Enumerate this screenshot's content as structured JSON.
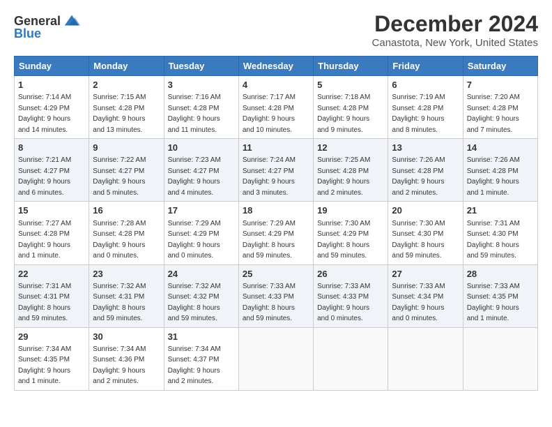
{
  "header": {
    "logo_general": "General",
    "logo_blue": "Blue",
    "main_title": "December 2024",
    "subtitle": "Canastota, New York, United States"
  },
  "days_of_week": [
    "Sunday",
    "Monday",
    "Tuesday",
    "Wednesday",
    "Thursday",
    "Friday",
    "Saturday"
  ],
  "weeks": [
    [
      {
        "day": "1",
        "info": "Sunrise: 7:14 AM\nSunset: 4:29 PM\nDaylight: 9 hours\nand 14 minutes."
      },
      {
        "day": "2",
        "info": "Sunrise: 7:15 AM\nSunset: 4:28 PM\nDaylight: 9 hours\nand 13 minutes."
      },
      {
        "day": "3",
        "info": "Sunrise: 7:16 AM\nSunset: 4:28 PM\nDaylight: 9 hours\nand 11 minutes."
      },
      {
        "day": "4",
        "info": "Sunrise: 7:17 AM\nSunset: 4:28 PM\nDaylight: 9 hours\nand 10 minutes."
      },
      {
        "day": "5",
        "info": "Sunrise: 7:18 AM\nSunset: 4:28 PM\nDaylight: 9 hours\nand 9 minutes."
      },
      {
        "day": "6",
        "info": "Sunrise: 7:19 AM\nSunset: 4:28 PM\nDaylight: 9 hours\nand 8 minutes."
      },
      {
        "day": "7",
        "info": "Sunrise: 7:20 AM\nSunset: 4:28 PM\nDaylight: 9 hours\nand 7 minutes."
      }
    ],
    [
      {
        "day": "8",
        "info": "Sunrise: 7:21 AM\nSunset: 4:27 PM\nDaylight: 9 hours\nand 6 minutes."
      },
      {
        "day": "9",
        "info": "Sunrise: 7:22 AM\nSunset: 4:27 PM\nDaylight: 9 hours\nand 5 minutes."
      },
      {
        "day": "10",
        "info": "Sunrise: 7:23 AM\nSunset: 4:27 PM\nDaylight: 9 hours\nand 4 minutes."
      },
      {
        "day": "11",
        "info": "Sunrise: 7:24 AM\nSunset: 4:27 PM\nDaylight: 9 hours\nand 3 minutes."
      },
      {
        "day": "12",
        "info": "Sunrise: 7:25 AM\nSunset: 4:28 PM\nDaylight: 9 hours\nand 2 minutes."
      },
      {
        "day": "13",
        "info": "Sunrise: 7:26 AM\nSunset: 4:28 PM\nDaylight: 9 hours\nand 2 minutes."
      },
      {
        "day": "14",
        "info": "Sunrise: 7:26 AM\nSunset: 4:28 PM\nDaylight: 9 hours\nand 1 minute."
      }
    ],
    [
      {
        "day": "15",
        "info": "Sunrise: 7:27 AM\nSunset: 4:28 PM\nDaylight: 9 hours\nand 1 minute."
      },
      {
        "day": "16",
        "info": "Sunrise: 7:28 AM\nSunset: 4:28 PM\nDaylight: 9 hours\nand 0 minutes."
      },
      {
        "day": "17",
        "info": "Sunrise: 7:29 AM\nSunset: 4:29 PM\nDaylight: 9 hours\nand 0 minutes."
      },
      {
        "day": "18",
        "info": "Sunrise: 7:29 AM\nSunset: 4:29 PM\nDaylight: 8 hours\nand 59 minutes."
      },
      {
        "day": "19",
        "info": "Sunrise: 7:30 AM\nSunset: 4:29 PM\nDaylight: 8 hours\nand 59 minutes."
      },
      {
        "day": "20",
        "info": "Sunrise: 7:30 AM\nSunset: 4:30 PM\nDaylight: 8 hours\nand 59 minutes."
      },
      {
        "day": "21",
        "info": "Sunrise: 7:31 AM\nSunset: 4:30 PM\nDaylight: 8 hours\nand 59 minutes."
      }
    ],
    [
      {
        "day": "22",
        "info": "Sunrise: 7:31 AM\nSunset: 4:31 PM\nDaylight: 8 hours\nand 59 minutes."
      },
      {
        "day": "23",
        "info": "Sunrise: 7:32 AM\nSunset: 4:31 PM\nDaylight: 8 hours\nand 59 minutes."
      },
      {
        "day": "24",
        "info": "Sunrise: 7:32 AM\nSunset: 4:32 PM\nDaylight: 8 hours\nand 59 minutes."
      },
      {
        "day": "25",
        "info": "Sunrise: 7:33 AM\nSunset: 4:33 PM\nDaylight: 8 hours\nand 59 minutes."
      },
      {
        "day": "26",
        "info": "Sunrise: 7:33 AM\nSunset: 4:33 PM\nDaylight: 9 hours\nand 0 minutes."
      },
      {
        "day": "27",
        "info": "Sunrise: 7:33 AM\nSunset: 4:34 PM\nDaylight: 9 hours\nand 0 minutes."
      },
      {
        "day": "28",
        "info": "Sunrise: 7:33 AM\nSunset: 4:35 PM\nDaylight: 9 hours\nand 1 minute."
      }
    ],
    [
      {
        "day": "29",
        "info": "Sunrise: 7:34 AM\nSunset: 4:35 PM\nDaylight: 9 hours\nand 1 minute."
      },
      {
        "day": "30",
        "info": "Sunrise: 7:34 AM\nSunset: 4:36 PM\nDaylight: 9 hours\nand 2 minutes."
      },
      {
        "day": "31",
        "info": "Sunrise: 7:34 AM\nSunset: 4:37 PM\nDaylight: 9 hours\nand 2 minutes."
      },
      null,
      null,
      null,
      null
    ]
  ]
}
